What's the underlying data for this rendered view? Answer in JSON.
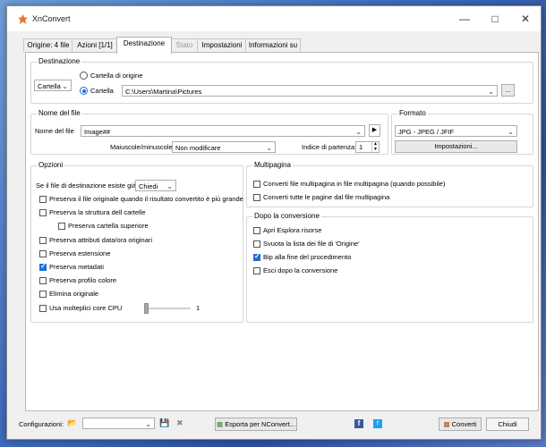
{
  "window": {
    "title": "XnConvert"
  },
  "tabs": [
    {
      "label": "Origine: 4 file"
    },
    {
      "label": "Azioni [1/1]"
    },
    {
      "label": "Destinazione"
    },
    {
      "label": "Stato"
    },
    {
      "label": "Impostazioni"
    },
    {
      "label": "Informazioni su"
    }
  ],
  "destinazione": {
    "legend": "Destinazione",
    "mode_select": "Cartella",
    "radio_origin_label": "Cartella di origine",
    "radio_folder_label": "Cartella",
    "path": "C:\\Users\\Martina\\Pictures",
    "browse_label": "..."
  },
  "nome_file": {
    "legend": "Nome del file",
    "label": "Nome del file",
    "value": "Image##",
    "case_label": "Maiuscole/minuscole",
    "case_value": "Non modificare",
    "start_label": "Indice di partenza",
    "start_value": "1"
  },
  "formato": {
    "legend": "Formato",
    "value": "JPG - JPEG / JFIF",
    "settings_label": "Impostazioni..."
  },
  "opzioni": {
    "legend": "Opzioni",
    "exists_label": "Se il file di destinazione esiste già",
    "exists_value": "Chiedi",
    "items": [
      {
        "label": "Preserva il file originale quando il risultato convertito è più grande",
        "checked": false
      },
      {
        "label": "Preserva la struttura dell cartelle",
        "checked": false
      },
      {
        "label": "Preserva cartella superiore",
        "checked": false
      },
      {
        "label": "Preserva attributi data/ora originari",
        "checked": false
      },
      {
        "label": "Preserva estensione",
        "checked": false
      },
      {
        "label": "Preserva metadati",
        "checked": true
      },
      {
        "label": "Preserva profilo colore",
        "checked": false
      },
      {
        "label": "Elimina originale",
        "checked": false
      },
      {
        "label": "Usa molteplici core CPU",
        "checked": false
      }
    ],
    "cpu_value": "1"
  },
  "multipagina": {
    "legend": "Multipagina",
    "items": [
      {
        "label": "Converti file multipagina in file multipagina (quando possibile)",
        "checked": false
      },
      {
        "label": "Converti tutte le pagine dal file multipagina",
        "checked": false
      }
    ]
  },
  "dopo": {
    "legend": "Dopo la conversione",
    "items": [
      {
        "label": "Apri Esplora risorse",
        "checked": false
      },
      {
        "label": "Svuota la lista dei file di 'Origine'",
        "checked": false
      },
      {
        "label": "Bip alla fine del procedimento",
        "checked": true
      },
      {
        "label": "Esci dopo la conversione",
        "checked": false
      }
    ]
  },
  "footer": {
    "config_label": "Configurazioni:",
    "export_label": "Esporta per NConvert...",
    "convert_label": "Converti",
    "close_label": "Chiudi"
  },
  "colors": {
    "accent": "#1f6fd6",
    "facebook": "#3b5998",
    "twitter": "#1da1f2"
  }
}
